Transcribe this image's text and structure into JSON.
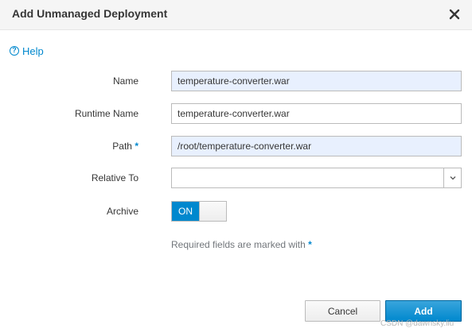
{
  "dialog": {
    "title": "Add Unmanaged Deployment",
    "close_icon": "close-icon"
  },
  "help": {
    "label": "Help",
    "icon": "question-circle-icon"
  },
  "form": {
    "name": {
      "label": "Name",
      "value": "temperature-converter.war"
    },
    "runtime_name": {
      "label": "Runtime Name",
      "value": "temperature-converter.war"
    },
    "path": {
      "label": "Path",
      "required_marker": "*",
      "value": "/root/temperature-converter.war"
    },
    "relative_to": {
      "label": "Relative To",
      "value": "",
      "icon": "chevron-down-icon"
    },
    "archive": {
      "label": "Archive",
      "state_label": "ON"
    }
  },
  "required_note": {
    "text": "Required fields are marked with",
    "marker": "*"
  },
  "buttons": {
    "cancel": "Cancel",
    "add": "Add"
  },
  "watermark": "CSDN @dawnsky.liu",
  "colors": {
    "accent": "#0088ce",
    "autofill": "#e8f0fe",
    "header_bg": "#f5f5f5"
  }
}
